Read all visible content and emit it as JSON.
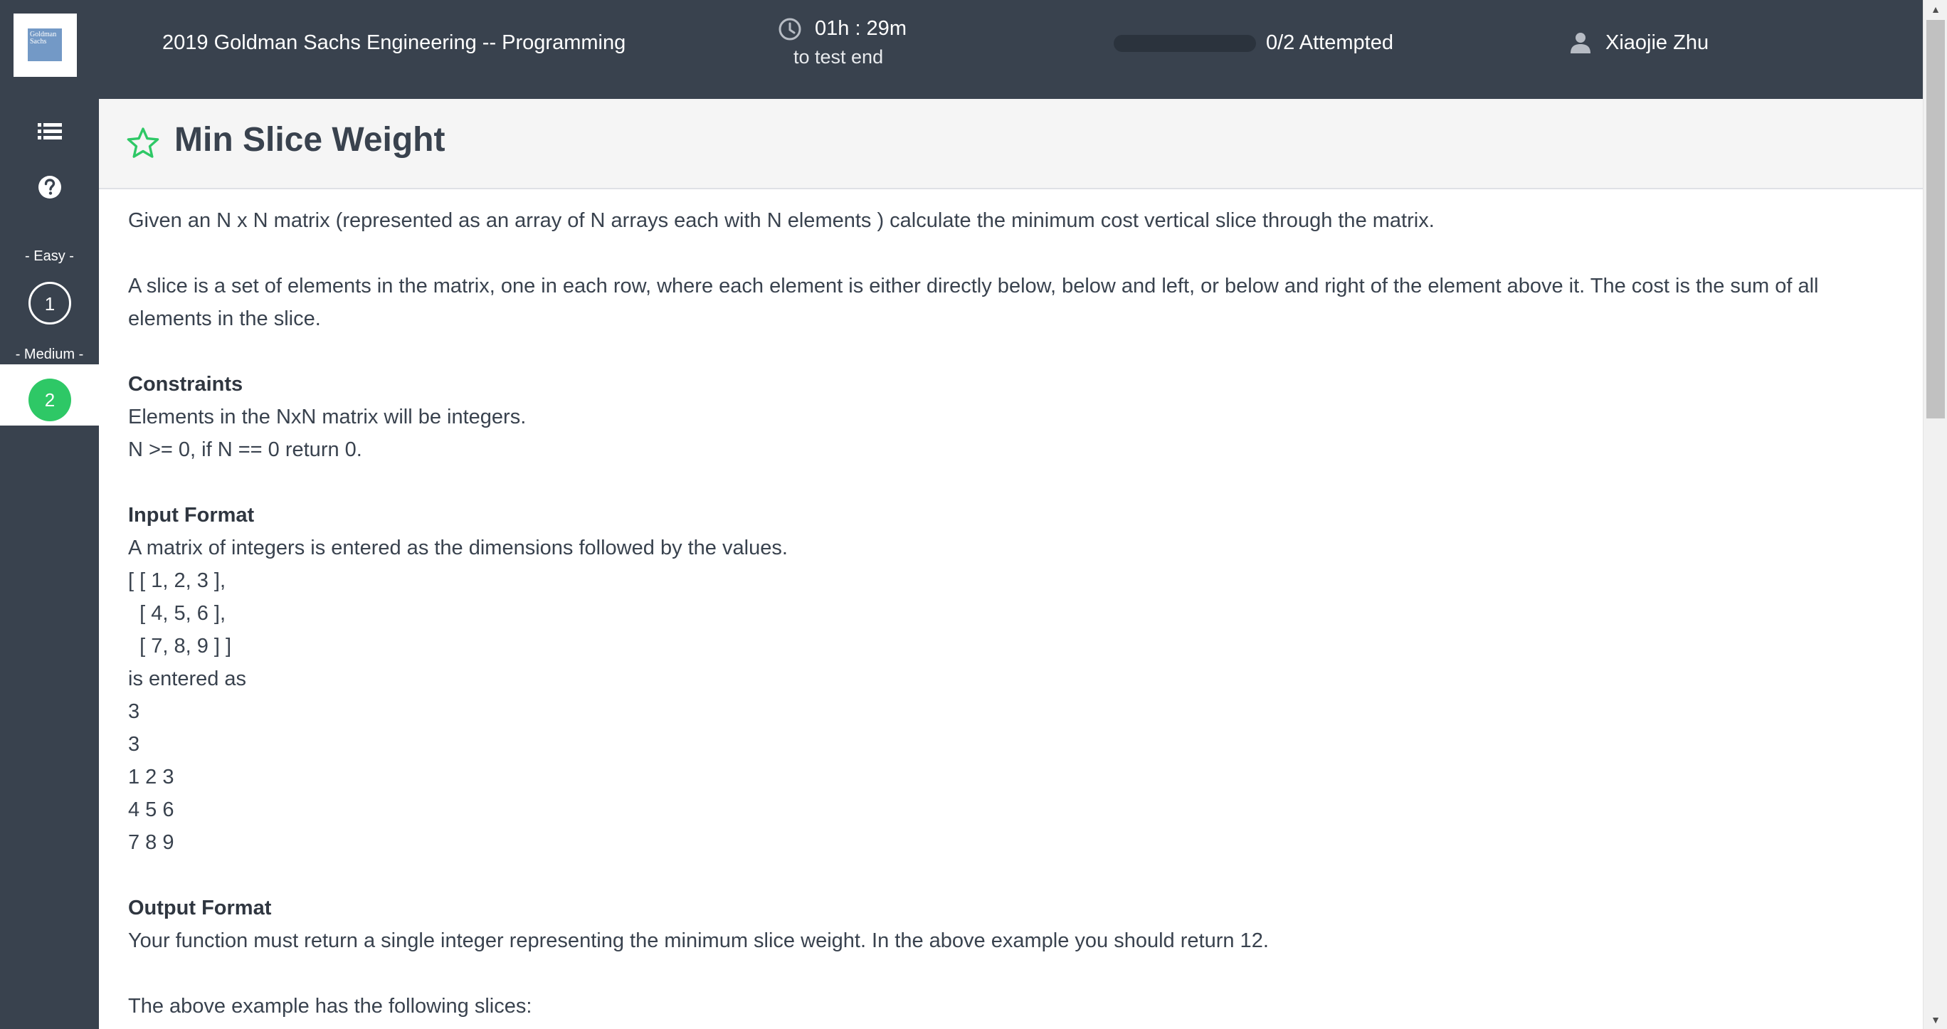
{
  "header": {
    "logo_text": "Goldman Sachs",
    "test_title": "2019 Goldman Sachs Engineering -- Programming",
    "timer_value": "01h : 29m",
    "timer_sub": "to test end",
    "progress_fraction": 0,
    "attempted": "0/2 Attempted",
    "user_name": "Xiaojie Zhu"
  },
  "sidebar": {
    "levels": [
      {
        "label": "- Easy -",
        "question": "1"
      },
      {
        "label": "- Medium -",
        "question": "2"
      }
    ]
  },
  "colors": {
    "header_bg": "#39424e",
    "accent_green": "#2ec866",
    "text": "#39424e"
  },
  "problem": {
    "title": "Min Slice Weight",
    "intro": "Given an N x N matrix (represented as an array of N arrays each with N elements ) calculate the minimum cost vertical slice through the matrix.",
    "slice_def": "A slice is a set of elements in the matrix, one in each row, where each element is either directly below, below and left, or below and right of the element above it. The cost is the sum of all elements in the slice.",
    "constraints_heading": "Constraints",
    "constraints": [
      "Elements in the NxN matrix will be integers.",
      "N >= 0, if N == 0 return 0."
    ],
    "input_heading": "Input Format",
    "input_lines": [
      "A matrix of integers is entered as the dimensions followed by the values.",
      "[ [ 1, 2, 3 ],",
      "  [ 4, 5, 6 ],",
      "  [ 7, 8, 9 ] ]",
      "is entered as",
      "3",
      "3",
      "1 2 3",
      "4 5 6",
      "7 8 9"
    ],
    "output_heading": "Output Format",
    "output_text": "Your function must return a single integer representing the minimum slice weight. In the above example you should return 12.",
    "slices_intro": "The above example has the following slices:"
  }
}
